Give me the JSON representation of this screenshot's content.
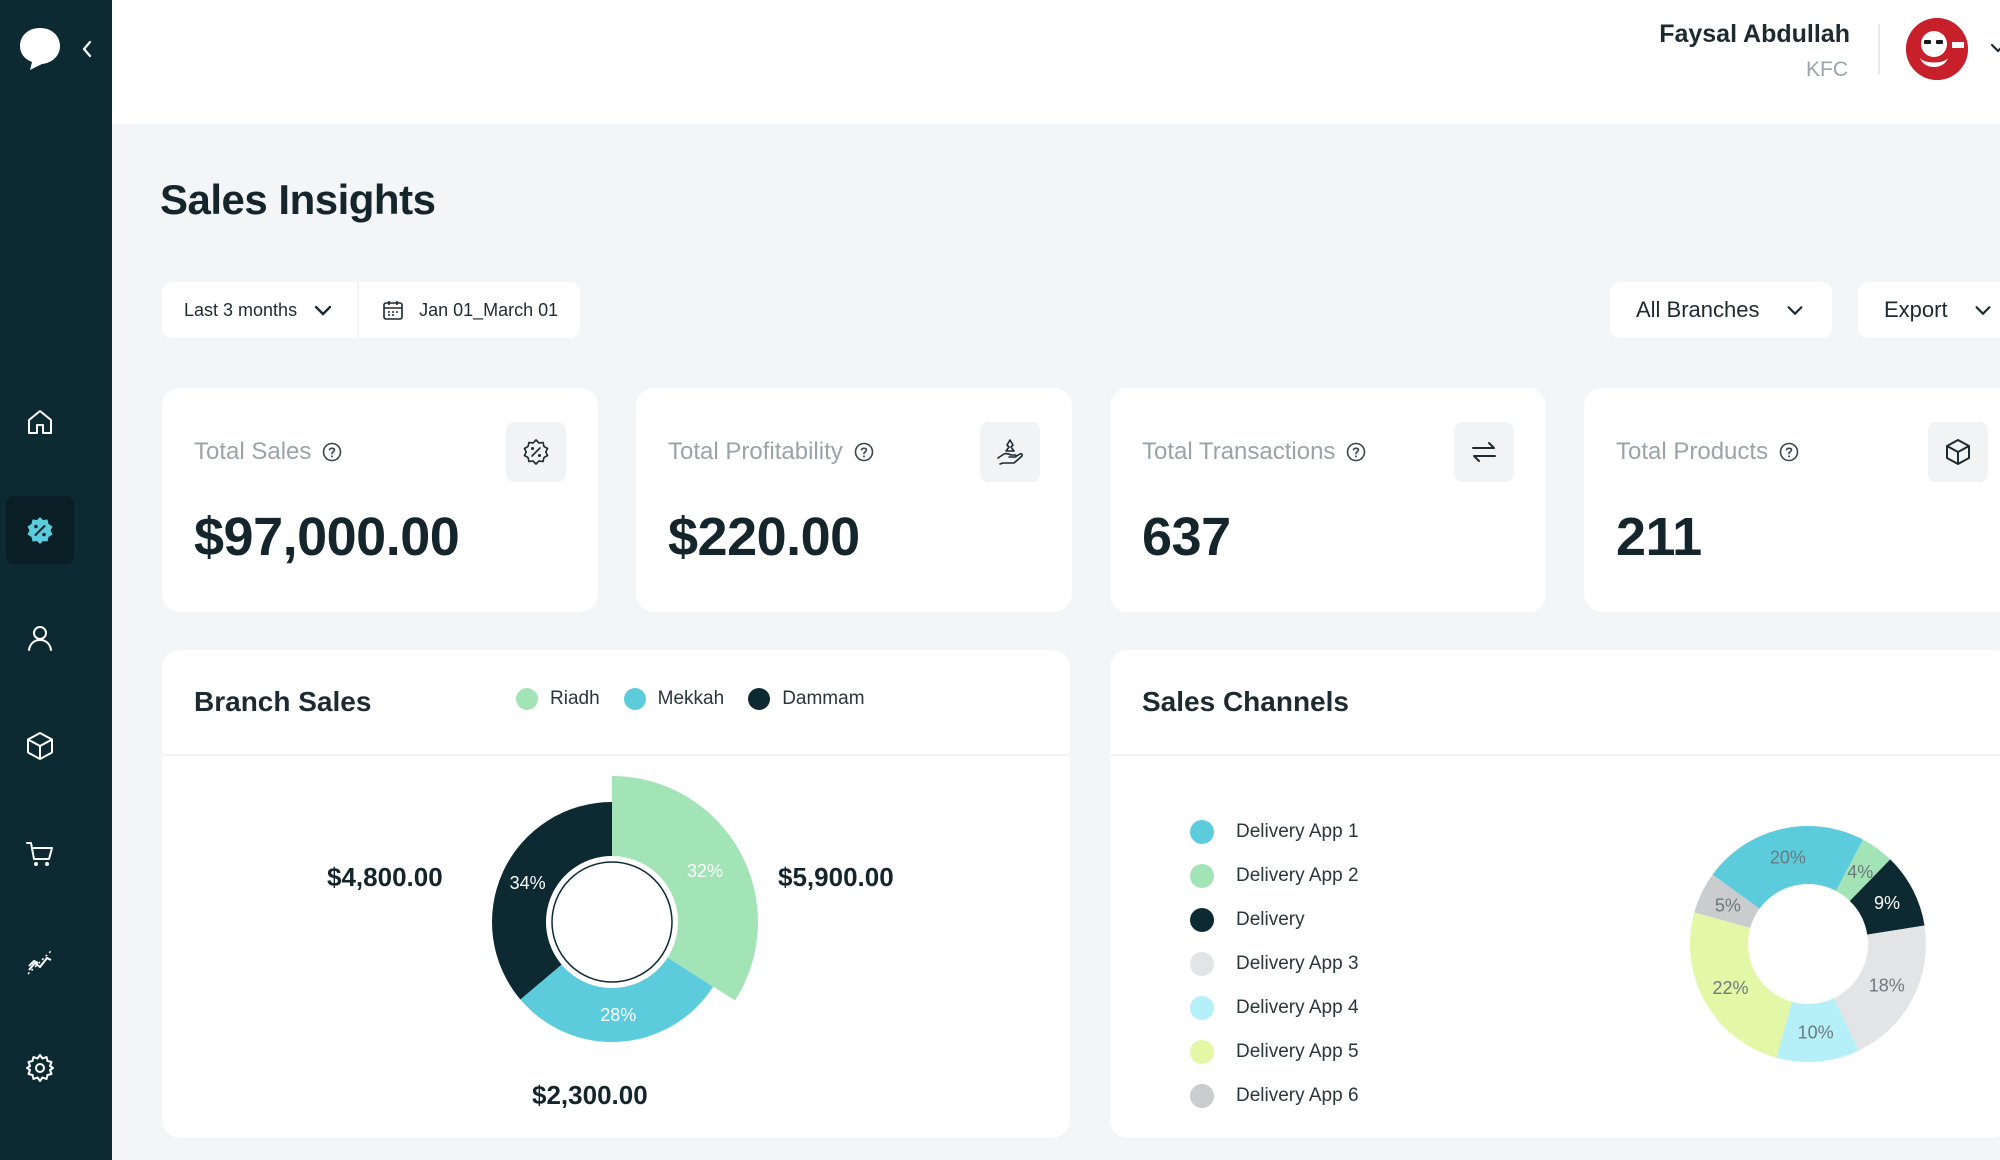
{
  "user": {
    "name": "Faysal Abdullah",
    "org": "KFC"
  },
  "page": {
    "title": "Sales Insights"
  },
  "filters": {
    "period": "Last 3 months",
    "date_range": "Jan 01_March 01",
    "branches": "All Branches",
    "export": "Export"
  },
  "kpis": [
    {
      "label": "Total Sales",
      "value": "$97,000.00",
      "icon": "percent-badge-icon"
    },
    {
      "label": "Total Profitability",
      "value": "$220.00",
      "icon": "money-hand-icon"
    },
    {
      "label": "Total Transactions",
      "value": "637",
      "icon": "swap-arrows-icon"
    },
    {
      "label": "Total Products",
      "value": "211",
      "icon": "box-icon"
    }
  ],
  "branch_sales": {
    "title": "Branch Sales",
    "legend": [
      {
        "name": "Riadh",
        "color": "#a3e4b7"
      },
      {
        "name": "Mekkah",
        "color": "#5cccdc"
      },
      {
        "name": "Dammam",
        "color": "#0d2a32"
      }
    ],
    "labels": {
      "riadh": "$5,900.00",
      "mekkah": "$4,800.00",
      "dammam": "$2,300.00"
    }
  },
  "sales_channels": {
    "title": "Sales Channels",
    "legend": [
      {
        "name": "Delivery App 1",
        "color": "#5cccdc"
      },
      {
        "name": "Delivery App 2",
        "color": "#a3e4b7"
      },
      {
        "name": "Delivery",
        "color": "#0d2a32"
      },
      {
        "name": "Delivery App 3",
        "color": "#e2e4e5"
      },
      {
        "name": "Delivery App 4",
        "color": "#b5f0f8"
      },
      {
        "name": "Delivery App 5",
        "color": "#e2f8a6"
      },
      {
        "name": "Delivery App 6",
        "color": "#cacccd"
      }
    ]
  },
  "chart_data": [
    {
      "type": "pie",
      "title": "Branch Sales",
      "categories": [
        "Riadh",
        "Mekkah",
        "Dammam"
      ],
      "values": [
        32,
        28,
        34
      ],
      "value_labels": [
        "32%",
        "28%",
        "34%"
      ],
      "amounts": [
        "$5,900.00",
        "$4,800.00",
        "$2,300.00"
      ],
      "colors": [
        "#a3e4b7",
        "#5cccdc",
        "#0d2a32"
      ]
    },
    {
      "type": "pie",
      "title": "Sales Channels",
      "categories": [
        "Delivery App 1",
        "Delivery App 2",
        "Delivery",
        "Delivery App 3",
        "Delivery App 4",
        "Delivery App 5",
        "Delivery App 6"
      ],
      "values": [
        20,
        4,
        9,
        18,
        10,
        22,
        5
      ],
      "value_labels": [
        "20%",
        "4%",
        "9%",
        "18%",
        "10%",
        "22%",
        "5%"
      ],
      "colors": [
        "#5cccdc",
        "#a3e4b7",
        "#0d2a32",
        "#e2e4e5",
        "#b5f0f8",
        "#e2f8a6",
        "#cacccd"
      ]
    }
  ]
}
